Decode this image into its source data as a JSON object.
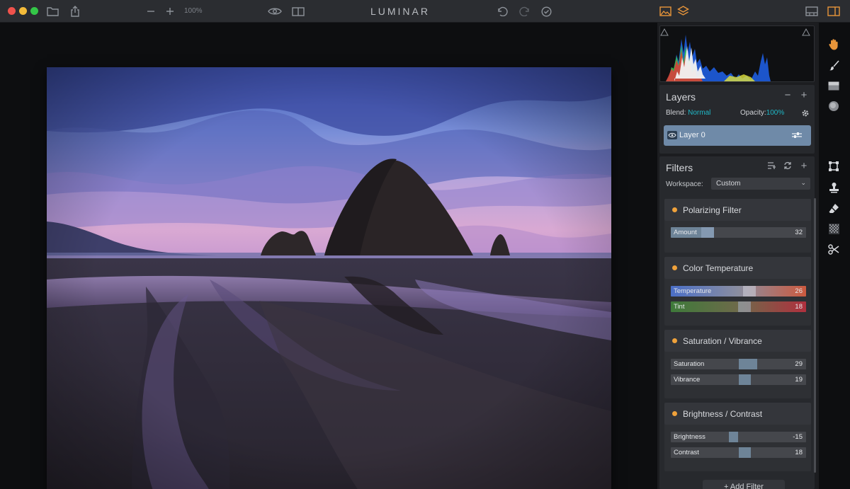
{
  "app": {
    "title": "LUMINAR",
    "zoom": "100%"
  },
  "layers": {
    "title": "Layers",
    "blend_label": "Blend:",
    "blend_value": "Normal",
    "opacity_label": "Opacity:",
    "opacity_value": "100%",
    "items": [
      {
        "name": "Layer 0"
      }
    ]
  },
  "filters": {
    "title": "Filters",
    "workspace_label": "Workspace:",
    "workspace_value": "Custom",
    "cards": [
      {
        "name": "Polarizing Filter",
        "sliders": [
          {
            "label": "Amount",
            "value": "32",
            "position": 0.32
          }
        ]
      },
      {
        "name": "Color Temperature",
        "sliders": [
          {
            "label": "Temperature",
            "value": "26",
            "position": 0.63
          },
          {
            "label": "Tint",
            "value": "18",
            "position": 0.59
          }
        ]
      },
      {
        "name": "Saturation / Vibrance",
        "sliders": [
          {
            "label": "Saturation",
            "value": "29",
            "position": 0.64
          },
          {
            "label": "Vibrance",
            "value": "19",
            "position": 0.59
          }
        ]
      },
      {
        "name": "Brightness / Contrast",
        "sliders": [
          {
            "label": "Brightness",
            "value": "-15",
            "position": 0.43
          },
          {
            "label": "Contrast",
            "value": "18",
            "position": 0.59
          }
        ]
      }
    ],
    "add_label": "Add Filter"
  },
  "colors": {
    "accent": "#1fb8c7",
    "filter_dot": "#f0a23b",
    "layer_selected": "#6f8aa8",
    "temperature_gradient": [
      "#4b6fc7",
      "#cc5a3f"
    ],
    "tint_gradient": [
      "#3e7a3a",
      "#b0303e"
    ]
  },
  "toolbar_icons": [
    "close-window",
    "minimize-window",
    "maximize-window",
    "folder-icon",
    "share-icon",
    "zoom-out-icon",
    "zoom-in-icon",
    "eye-icon",
    "split-view-icon",
    "undo-icon",
    "redo-icon",
    "check-circle-icon",
    "image-icon",
    "layers-stack-icon",
    "filmstrip-icon",
    "sidebar-icon"
  ],
  "tools": [
    "hand-icon",
    "brush-icon",
    "gradient-icon",
    "radial-icon",
    "crop-icon",
    "clone-stamp-icon",
    "eraser-icon",
    "noise-icon",
    "scissors-icon"
  ]
}
